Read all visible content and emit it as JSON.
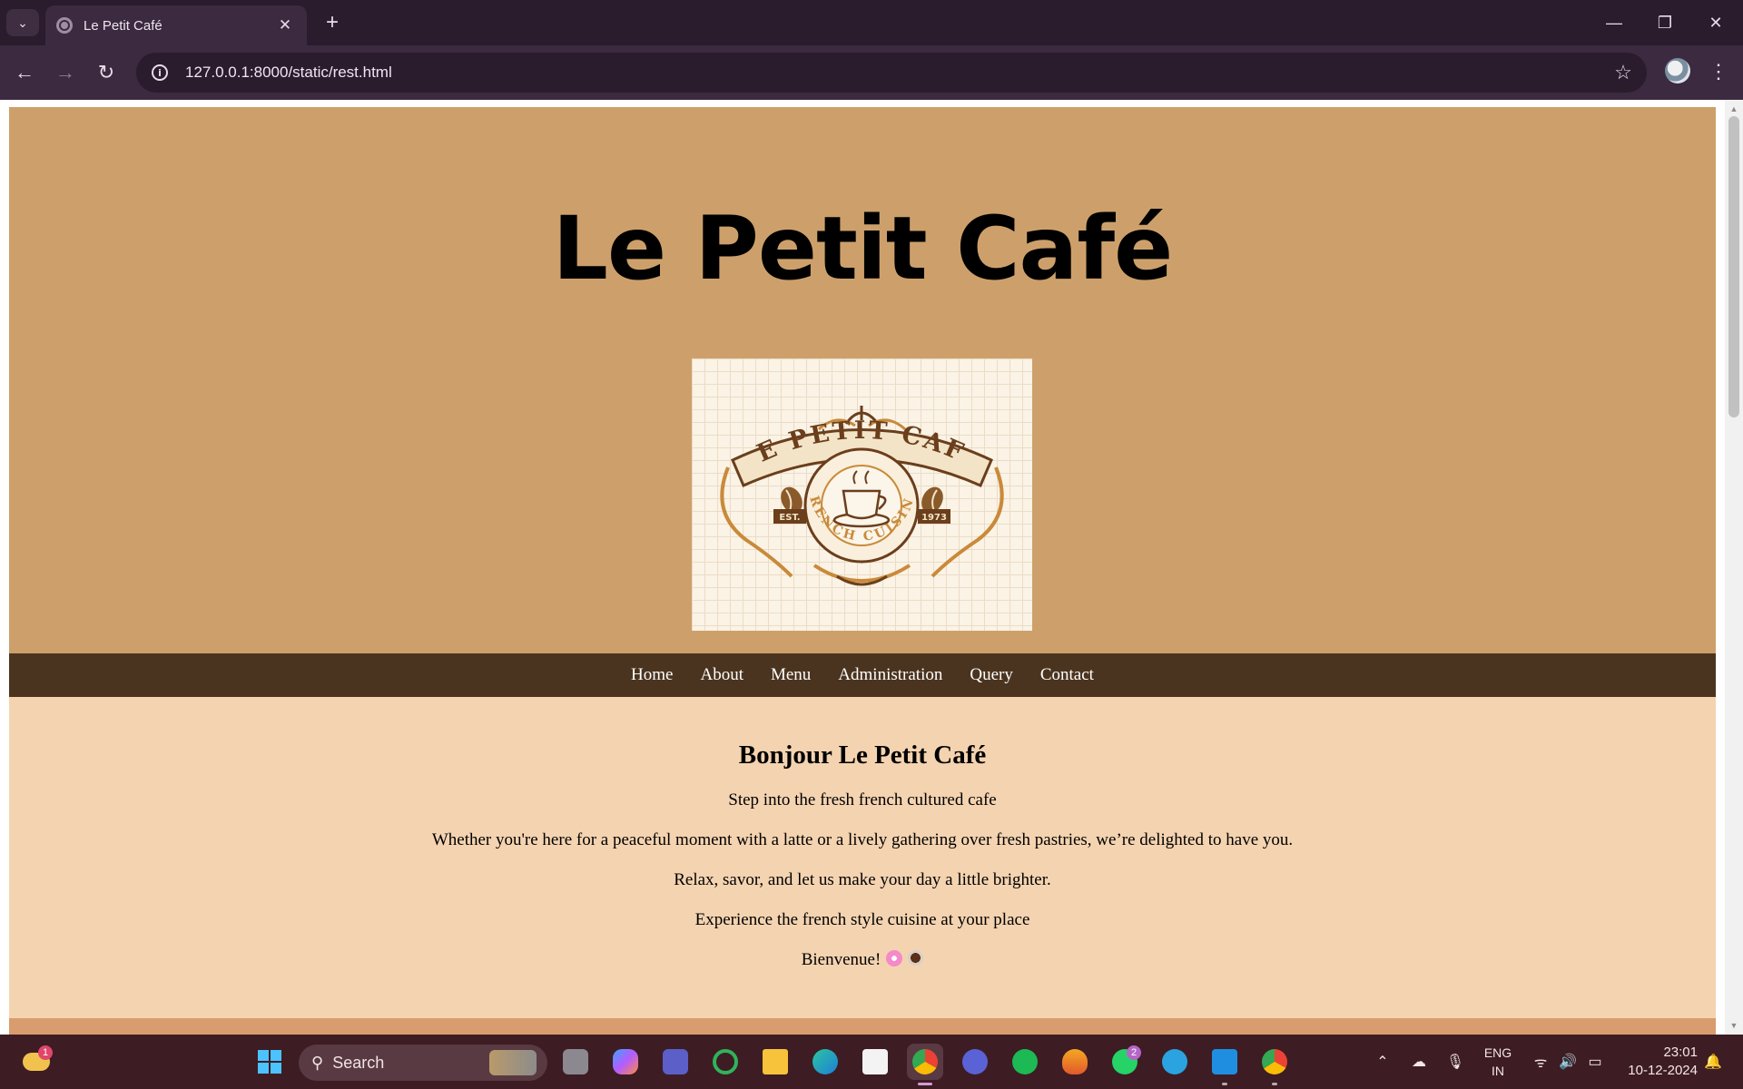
{
  "browser": {
    "tab_title": "Le Petit Café",
    "url": "127.0.0.1:8000/static/rest.html",
    "new_tab_icon": "+",
    "close_tab_icon": "✕"
  },
  "site": {
    "title": "Le Petit Café",
    "logo": {
      "alt": "Le Petit Café logo",
      "top_text": "LE PETIT CAFE",
      "ring_text": "FRENCH CUISINE",
      "est_label": "EST.",
      "year": "1973",
      "colors": {
        "brown": "#6b3e1c",
        "gold": "#c98a3a",
        "paper": "#faf3e6"
      }
    },
    "nav": [
      "Home",
      "About",
      "Menu",
      "Administration",
      "Query",
      "Contact"
    ],
    "welcome": {
      "heading": "Bonjour Le Petit Café",
      "lines": [
        "Step into the fresh french cultured cafe",
        "Whether you're here for a peaceful moment with a latte or a lively gathering over fresh pastries, we’re delighted to have you.",
        "Relax, savor, and let us make your day a little brighter.",
        "Experience the french style cuisine at your place"
      ],
      "closing": "Bienvenue!"
    },
    "colors": {
      "hero": "#cda06b",
      "nav": "#4b341f",
      "welcome": "#f4d3b0"
    }
  },
  "taskbar": {
    "search_label": "Search",
    "weather_badge": "1",
    "whatsapp_badge": "2",
    "lang_line1": "ENG",
    "lang_line2": "IN",
    "time": "23:01",
    "date": "10-12-2024",
    "apps": [
      "start-icon",
      "task-view-icon",
      "copilot-icon",
      "teams-icon",
      "xbox-icon",
      "file-explorer-icon",
      "edge-icon",
      "store-icon",
      "chrome-icon",
      "vector-app-icon",
      "spotify-icon",
      "fl-studio-icon",
      "whatsapp-icon",
      "telegram-icon",
      "vscode-icon",
      "chrome-icon"
    ]
  }
}
